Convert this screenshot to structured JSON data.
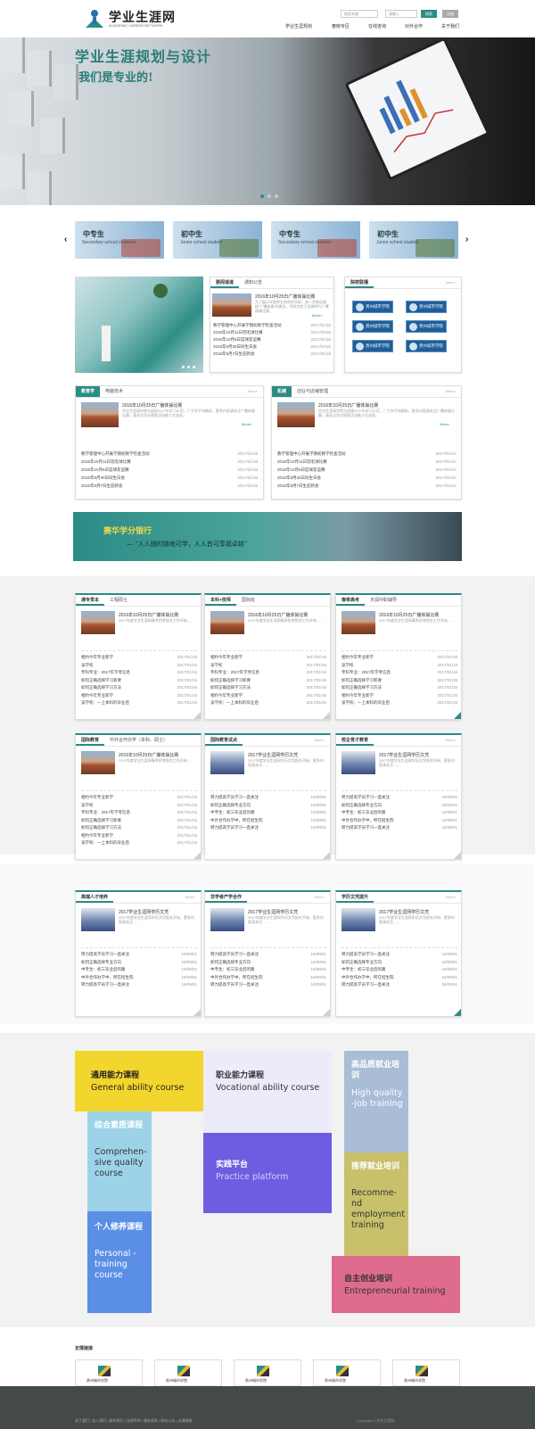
{
  "header": {
    "logo_title": "学业生涯网",
    "logo_sub": "ACADEMIC CAREER NETWORK",
    "search1": "搜索关键",
    "search2": "请输入",
    "search_btn": "搜索",
    "login_btn": "注册",
    "nav": [
      "学业生涯规划",
      "春晓专区",
      "在线咨询",
      "对外合作",
      "关于我们"
    ]
  },
  "hero": {
    "title": "学业生涯规划与设计",
    "subtitle": "我们是专业的!"
  },
  "carousel": {
    "arrow_left": "‹",
    "arrow_right": "›",
    "items": [
      {
        "title": "中专生",
        "sub": "Secondary school students"
      },
      {
        "title": "初中生",
        "sub": "Junior school student"
      },
      {
        "title": "中专生",
        "sub": "Secondary school students"
      },
      {
        "title": "初中生",
        "sub": "Junior school student"
      }
    ]
  },
  "news": {
    "tabs": [
      "要闻速递",
      "通知公告"
    ],
    "feature_title": "2016年10月25日广播体操比赛",
    "feature_desc": "为了展示学院师生的良好风采，进一步推动我校“广播体操”的普及，学院决定于近期举行广播体操比赛。",
    "more": "More»",
    "items": [
      [
        "教学管理中心开展学期初教学检查活动",
        "2017/01/16"
      ],
      [
        "2016年10月11日羽毛球比赛",
        "2017/01/16"
      ],
      [
        "2016年10月6日篮球友谊赛",
        "2017/01/16"
      ],
      [
        "2016年9月30日同生日会",
        "2017/01/16"
      ],
      [
        "2016年9月7日生迎新会",
        "2017/01/16"
      ]
    ]
  },
  "partners": {
    "title": "院校联播",
    "more": "More»",
    "badge": "贵州城市学院"
  },
  "box_a": {
    "tab1": "教育学",
    "tab2": "电脑技术",
    "more": "More»",
    "feature_title": "2016年10月25日广播体操比赛",
    "feature_desc": "学业生涯网学院为迎接2017年学习示范，广大学子的精彩，更多内容请关注广播体操比赛，请关注学业规划活动推介交友处。",
    "more2": "More»",
    "items": [
      [
        "教学管理中心开展学期初教学检查活动",
        "2017/01/16"
      ],
      [
        "2016年10月11日羽毛球比赛",
        "2017/01/16"
      ],
      [
        "2016年10月6日篮球友谊赛",
        "2017/01/16"
      ],
      [
        "2016年9月30日同生日会",
        "2017/01/16"
      ],
      [
        "2016年9月7日生迎新会",
        "2017/01/16"
      ]
    ]
  },
  "box_b": {
    "tab1": "机械",
    "tab2": "创业与店铺管理",
    "more": "More»",
    "feature_title": "2016年10月25日广播体操比赛",
    "feature_desc": "学业生涯网学院为迎接2017年学习示范，广大学子的精彩，更多内容请关注广播体操比赛，请关注学业规划活动推介交友处。",
    "more2": "More»",
    "items": [
      [
        "教学管理中心开展学期初教学检查活动",
        "2017/01/16"
      ],
      [
        "2016年10月11日羽毛球比赛",
        "2017/01/16"
      ],
      [
        "2016年10月6日篮球友谊赛",
        "2017/01/16"
      ],
      [
        "2016年9月30日同生日会",
        "2017/01/16"
      ],
      [
        "2016年9月7日生迎新会",
        "2017/01/16"
      ]
    ]
  },
  "banner": {
    "title": "赛华学分银行",
    "subtitle": "— “人人随时随地可学，人人皆可享福卓越”"
  },
  "row1": [
    {
      "tabs": [
        "通专贯本",
        "工程硕士"
      ],
      "ft": "2016年10月25日广播体操比赛",
      "fd": "2017年度学业生涯网春季招考报名工作开始……",
      "items": [
        [
          "相约今年专业新学",
          "2017/01/16"
        ],
        [
          "该学校",
          "2017/01/16"
        ],
        [
          "专科专业：2017年学考信息",
          "2017/01/16"
        ],
        [
          "如何正确选择学习新要",
          "2017/01/16"
        ],
        [
          "如何正确选择学习方法",
          "2017/01/16"
        ],
        [
          "相约今年专业新学",
          "2017/01/16"
        ],
        [
          "该学校：一上本科的毕业后",
          "2017/01/16"
        ]
      ]
    },
    {
      "tabs": [
        "本科+技师",
        "国际班"
      ],
      "ft": "2016年10月25日广播体操比赛",
      "fd": "2017年度学业生涯网春季招考报名工作开始……",
      "items": [
        [
          "相约今年专业新学",
          "2017/01/16"
        ],
        [
          "该学校",
          "2017/01/16"
        ],
        [
          "专科专业：2017年学考信息",
          "2017/01/16"
        ],
        [
          "如何正确选择学习新要",
          "2017/01/16"
        ],
        [
          "如何正确选择学习方法",
          "2017/01/16"
        ],
        [
          "相约今年专业新学",
          "2017/01/16"
        ],
        [
          "该学校：一上本科的毕业后",
          "2017/01/16"
        ]
      ]
    },
    {
      "tabs": [
        "春季高考",
        "天润中职辅导"
      ],
      "ft": "2016年10月25日广播体操比赛",
      "fd": "2017年度学业生涯网春季招考报名工作开始……",
      "items": [
        [
          "相约今年专业新学",
          "2017/01/16"
        ],
        [
          "该学校",
          "2017/01/16"
        ],
        [
          "专科专业：2017年学考信息",
          "2017/01/16"
        ],
        [
          "如何正确选择学习新要",
          "2017/01/16"
        ],
        [
          "如何正确选择学习方法",
          "2017/01/16"
        ],
        [
          "相约今年专业新学",
          "2017/01/16"
        ],
        [
          "该学校：一上本科的毕业后",
          "2017/01/16"
        ]
      ]
    }
  ],
  "row2": [
    {
      "tabs": [
        "国际教育",
        "中外合作办学（本科、硕士）"
      ],
      "ft": "2016年10月25日广播体操比赛",
      "fd": "2017年度学业生涯网春季招考报名工作开始……",
      "items": [
        [
          "相约今年专业新学",
          "2017/01/16"
        ],
        [
          "该学校",
          "2017/01/16"
        ],
        [
          "专科专业：2017年学考信息",
          "2017/01/16"
        ],
        [
          "如何正确选择学习新要",
          "2017/01/16"
        ],
        [
          "如何正确选择学习方法",
          "2017/01/16"
        ],
        [
          "相约今年专业新学",
          "2017/01/16"
        ],
        [
          "该学校：一上本科的毕业后",
          "2017/01/16"
        ]
      ]
    },
    {
      "tabs": [
        "国际教育试点"
      ],
      "ft": "2017学业生涯网学历文凭",
      "fd": "2017年度学业生涯网学历文凭报名开始，更多内容请关注……",
      "items": [
        [
          "转力提高学员学习一直关注",
          "16/09/01"
        ],
        [
          "如何正确选择专业方向",
          "16/09/01"
        ],
        [
          "中专生：初三毕业后的路",
          "16/09/01"
        ],
        [
          "中外合作办学中，所在招生院",
          "16/09/01"
        ],
        [
          "转力提高学员学习一直关注",
          "16/09/01"
        ]
      ]
    },
    {
      "tabs": [
        "校企育才教育"
      ],
      "ft": "2017学业生涯网学历文凭",
      "fd": "2017年度学业生涯网学历文凭报名开始，更多内容请关注……",
      "items": [
        [
          "转力提高学员学习一直关注",
          "16/09/01"
        ],
        [
          "如何正确选择专业方向",
          "16/09/01"
        ],
        [
          "中专生：初三毕业后的路",
          "16/09/01"
        ],
        [
          "中外合作办学中，所在招生院",
          "16/09/01"
        ],
        [
          "转力提高学员学习一直关注",
          "16/09/01"
        ]
      ]
    }
  ],
  "row3": [
    {
      "tabs": [
        "高端人才培养"
      ],
      "ft": "2017学业生涯网学历文凭",
      "fd": "2017年度学业生涯网学历文凭报名开始，更多内容请关注……",
      "items": [
        [
          "转力提高学员学习一直关注",
          "16/09/01"
        ],
        [
          "如何正确选择专业方向",
          "16/09/01"
        ],
        [
          "中专生：初三毕业后的路",
          "16/09/01"
        ],
        [
          "中外合作办学中，所在招生院",
          "16/09/01"
        ],
        [
          "转力提高学员学习一直关注",
          "16/09/01"
        ]
      ]
    },
    {
      "tabs": [
        "非学者产学合作"
      ],
      "ft": "2017学业生涯网学历文凭",
      "fd": "2017年度学业生涯网学历文凭报名开始，更多内容请关注……",
      "items": [
        [
          "转力提高学员学习一直关注",
          "16/09/01"
        ],
        [
          "如何正确选择专业方向",
          "16/09/01"
        ],
        [
          "中专生：初三毕业后的路",
          "16/09/01"
        ],
        [
          "中外合作办学中，所在招生院",
          "16/09/01"
        ],
        [
          "转力提高学员学习一直关注",
          "16/09/01"
        ]
      ]
    },
    {
      "tabs": [
        "学历文凭提升"
      ],
      "ft": "2017学业生涯网学历文凭",
      "fd": "2017年度学业生涯网学历文凭报名开始，更多内容请关注……",
      "items": [
        [
          "转力提高学员学习一直关注",
          "16/09/01"
        ],
        [
          "如何正确选择专业方向",
          "16/09/01"
        ],
        [
          "中专生：初三毕业后的路",
          "16/09/01"
        ],
        [
          "中外合作办学中，所在招生院",
          "16/09/01"
        ],
        [
          "转力提高学员学习一直关注",
          "16/09/01"
        ]
      ]
    }
  ],
  "more_label": "More»",
  "courses": {
    "c1": {
      "cn": "通用能力课程",
      "en": "General ability course"
    },
    "c2": {
      "cn": "职业能力课程",
      "en": "Vocational ability course"
    },
    "c3": {
      "cn": "高品质就业培训",
      "en": "High quality -job training"
    },
    "c4": {
      "cn": "综合素质课程",
      "en": "Comprehen-sive quality course"
    },
    "c5": {
      "cn": "实践平台",
      "en": "Practice platform"
    },
    "c6": {
      "cn": "推荐就业培训",
      "en": "Recomme-nd employment training"
    },
    "c7": {
      "cn": "个人修养课程",
      "en": "Personal -training course"
    },
    "c8": {
      "cn": "自主创业培训",
      "en": "Entrepreneurial training"
    }
  },
  "friends": {
    "title": "友情链接",
    "name": "贵州城市学院"
  },
  "footer": {
    "links": "关于我们 | 加入我们 | 联系我们 | 法律声明 | 服务条款 | 网站公告 | 友情链接",
    "copy": "Copyright © 学业生涯网"
  },
  "colors": {
    "accent": "#2b8c86"
  }
}
